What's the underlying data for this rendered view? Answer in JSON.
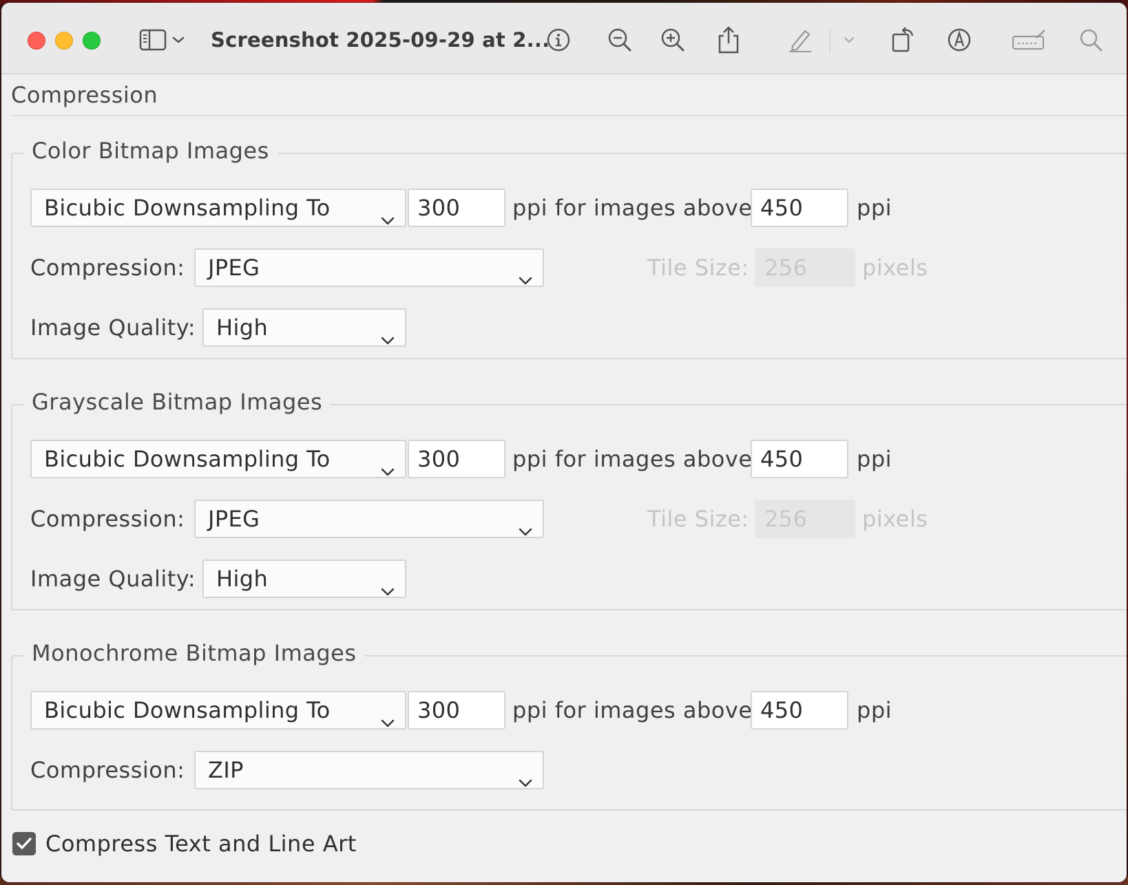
{
  "window": {
    "title": "Screenshot 2025-09-29 at 2...",
    "toolbar_icons": [
      "sidebar-icon",
      "chevron-down-icon",
      "info-icon",
      "zoom-out-icon",
      "zoom-in-icon",
      "share-icon",
      "markup-pen-icon",
      "chevron-down-icon",
      "rotate-icon",
      "annotate-icon",
      "signature-icon",
      "search-icon"
    ]
  },
  "section": {
    "title": "Compression"
  },
  "groups": [
    {
      "title": "Color Bitmap Images",
      "downsampling": "Bicubic Downsampling To",
      "ppi": "300",
      "ppi_label": "ppi for images above",
      "above_ppi": "450",
      "ppi_unit": "ppi",
      "compression_label": "Compression:",
      "compression": "JPEG",
      "tile_label": "Tile Size:",
      "tile_size": "256",
      "tile_unit": "pixels",
      "quality_label": "Image Quality:",
      "quality": "High"
    },
    {
      "title": "Grayscale Bitmap Images",
      "downsampling": "Bicubic Downsampling To",
      "ppi": "300",
      "ppi_label": "ppi for images above",
      "above_ppi": "450",
      "ppi_unit": "ppi",
      "compression_label": "Compression:",
      "compression": "JPEG",
      "tile_label": "Tile Size:",
      "tile_size": "256",
      "tile_unit": "pixels",
      "quality_label": "Image Quality:",
      "quality": "High"
    },
    {
      "title": "Monochrome Bitmap Images",
      "downsampling": "Bicubic Downsampling To",
      "ppi": "300",
      "ppi_label": "ppi for images above",
      "above_ppi": "450",
      "ppi_unit": "ppi",
      "compression_label": "Compression:",
      "compression": "ZIP"
    }
  ],
  "compress_text": {
    "label": "Compress Text and Line Art",
    "checked": true
  },
  "colors": {
    "traffic_close": "#fe5f57",
    "traffic_min": "#febc2e",
    "traffic_max": "#28c840",
    "checkbox": "#5a5a5a"
  }
}
